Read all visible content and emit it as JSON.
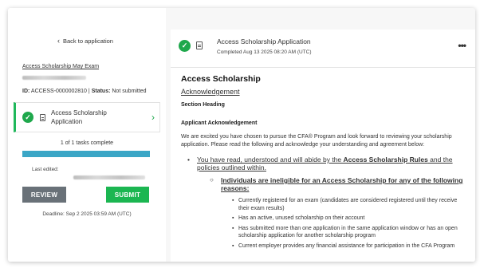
{
  "sidebar": {
    "back_label": "Back to application",
    "exam_link": "Access Scholarship May Exam",
    "id_label": "ID:",
    "id_value": "ACCESS-0000002810",
    "status_label": "Status:",
    "status_value": "Not submitted",
    "task_label": "Access Scholarship Application",
    "progress_text": "1 of 1 tasks complete",
    "progress_fraction": 1.0,
    "edited_label": "Last edited:",
    "review_label": "REVIEW",
    "submit_label": "SUBMIT",
    "deadline": "Deadline: Sep 2 2025 03:59 AM (UTC)"
  },
  "header": {
    "title": "Access Scholarship Application",
    "subtitle": "Completed Aug 13 2025 08:20 AM (UTC)",
    "more_label": "•••"
  },
  "content": {
    "heading": "Access Scholarship",
    "ack_link": "Acknowledgement",
    "section_heading": "Section Heading",
    "applicant_heading": "Applicant Acknowledgement",
    "intro": "We are excited you have chosen to pursue the CFA® Program and look forward to reviewing your scholarship application. Please read the following and acknowledge your understanding and agreement below:",
    "bullet1_a": "You have read, understood and will abide by the ",
    "bullet1_b": "Access Scholarship Rules",
    "bullet1_c": " and the policies outlined within.",
    "bullet2": "Individuals are ineligible for an Access Scholarship for any of the following reasons:",
    "items": [
      "Currently registered for an exam (candidates are considered registered until they receive their exam results)",
      "Has an active, unused scholarship on their account",
      "Has submitted more than one application in the same application window or has an open scholarship application for another scholarship program",
      "Current employer provides any financial assistance for participation in the CFA Program"
    ]
  },
  "colors": {
    "accent_green": "#1bb651",
    "progress_blue": "#3ba6c6",
    "review_gray": "#697178"
  }
}
